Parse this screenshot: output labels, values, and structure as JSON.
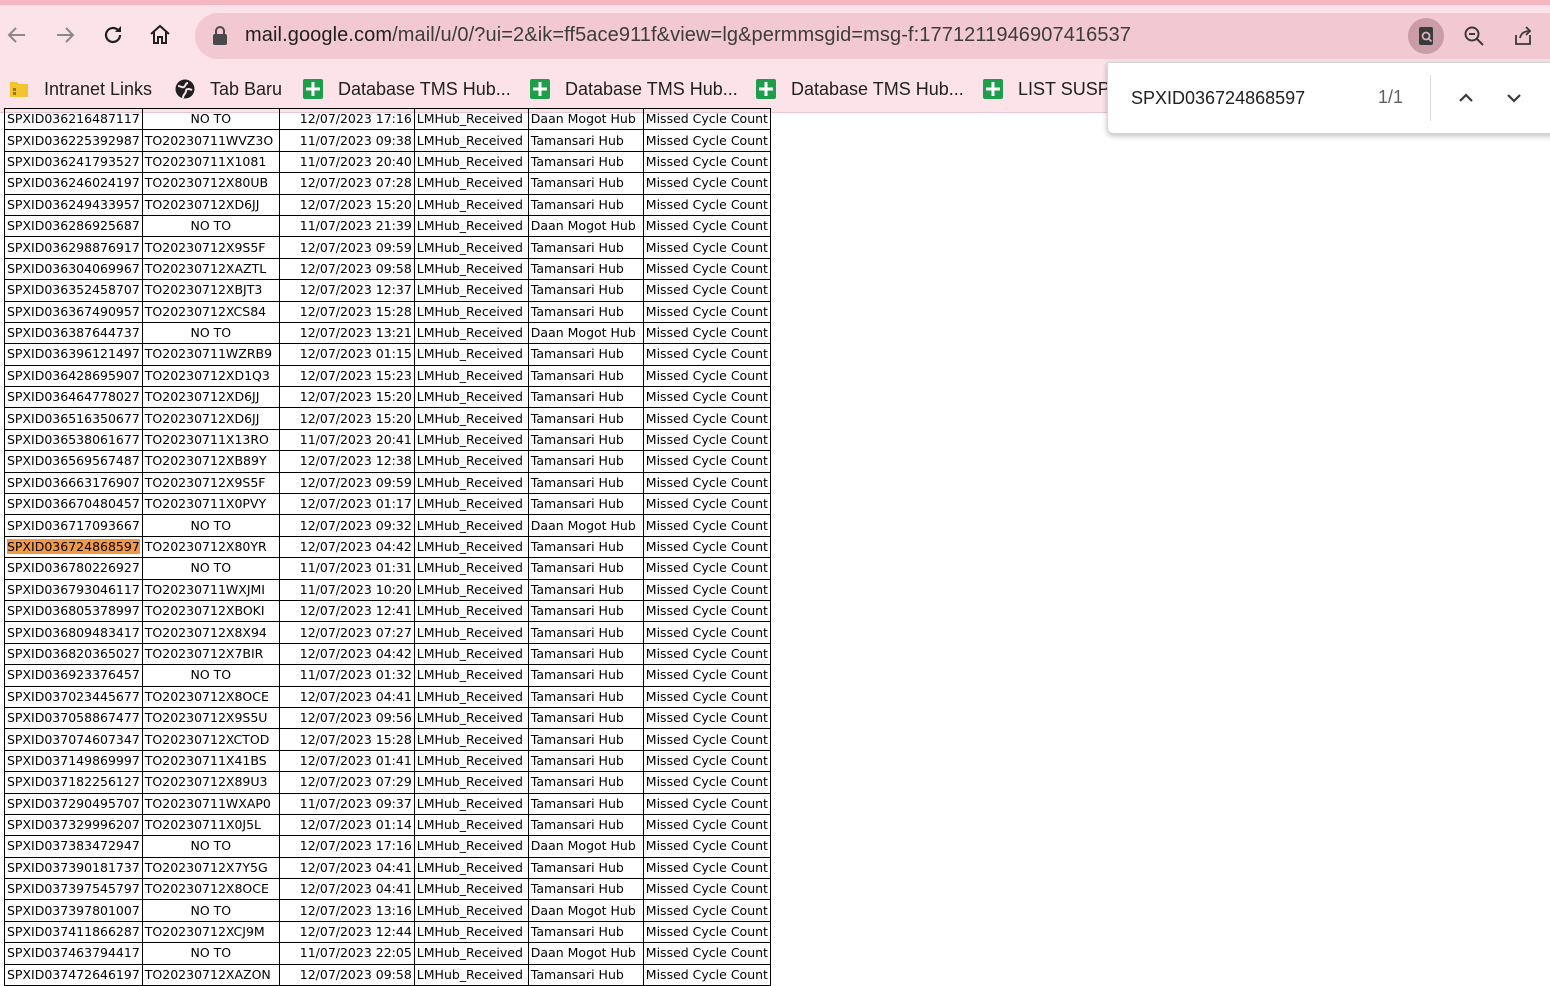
{
  "browser": {
    "url_host": "mail.google.com",
    "url_path": "/mail/u/0/?ui=2&ik=ff5ace911f&view=lg&permmsgid=msg-f:1771211946907416537",
    "icons": [
      "back-icon",
      "forward-icon",
      "reload-icon",
      "home-icon",
      "lock-icon",
      "find-icon",
      "zoom-icon",
      "share-icon"
    ]
  },
  "bookmarks": [
    {
      "label": "Intranet Links",
      "icon": "folder-icon"
    },
    {
      "label": "Tab Baru",
      "icon": "globe-icon"
    },
    {
      "label": "Database TMS Hub...",
      "icon": "sheets-icon"
    },
    {
      "label": "Database TMS Hub...",
      "icon": "sheets-icon"
    },
    {
      "label": "Database TMS Hub...",
      "icon": "sheets-icon"
    },
    {
      "label": "LIST SUSPEI",
      "icon": "sheets-icon"
    }
  ],
  "find_bar": {
    "query": "SPXID036724868597",
    "count": "1/1"
  },
  "highlight_color": "#f19a45",
  "table": {
    "rows": [
      [
        "SPXID036216487117",
        "NO TO",
        "12/07/2023 17:16",
        "LMHub_Received",
        "Daan Mogot Hub",
        "Missed Cycle Count"
      ],
      [
        "SPXID036225392987",
        "TO20230711WVZ3O",
        "11/07/2023 09:38",
        "LMHub_Received",
        "Tamansari Hub",
        "Missed Cycle Count"
      ],
      [
        "SPXID036241793527",
        "TO20230711X1081",
        "11/07/2023 20:40",
        "LMHub_Received",
        "Tamansari Hub",
        "Missed Cycle Count"
      ],
      [
        "SPXID036246024197",
        "TO20230712X80UB",
        "12/07/2023 07:28",
        "LMHub_Received",
        "Tamansari Hub",
        "Missed Cycle Count"
      ],
      [
        "SPXID036249433957",
        "TO20230712XD6JJ",
        "12/07/2023 15:20",
        "LMHub_Received",
        "Tamansari Hub",
        "Missed Cycle Count"
      ],
      [
        "SPXID036286925687",
        "NO TO",
        "11/07/2023 21:39",
        "LMHub_Received",
        "Daan Mogot Hub",
        "Missed Cycle Count"
      ],
      [
        "SPXID036298876917",
        "TO20230712X9S5F",
        "12/07/2023 09:59",
        "LMHub_Received",
        "Tamansari Hub",
        "Missed Cycle Count"
      ],
      [
        "SPXID036304069967",
        "TO20230712XAZTL",
        "12/07/2023 09:58",
        "LMHub_Received",
        "Tamansari Hub",
        "Missed Cycle Count"
      ],
      [
        "SPXID036352458707",
        "TO20230712XBJT3",
        "12/07/2023 12:37",
        "LMHub_Received",
        "Tamansari Hub",
        "Missed Cycle Count"
      ],
      [
        "SPXID036367490957",
        "TO20230712XCS84",
        "12/07/2023 15:28",
        "LMHub_Received",
        "Tamansari Hub",
        "Missed Cycle Count"
      ],
      [
        "SPXID036387644737",
        "NO TO",
        "12/07/2023 13:21",
        "LMHub_Received",
        "Daan Mogot Hub",
        "Missed Cycle Count"
      ],
      [
        "SPXID036396121497",
        "TO20230711WZRB9",
        "12/07/2023 01:15",
        "LMHub_Received",
        "Tamansari Hub",
        "Missed Cycle Count"
      ],
      [
        "SPXID036428695907",
        "TO20230712XD1Q3",
        "12/07/2023 15:23",
        "LMHub_Received",
        "Tamansari Hub",
        "Missed Cycle Count"
      ],
      [
        "SPXID036464778027",
        "TO20230712XD6JJ",
        "12/07/2023 15:20",
        "LMHub_Received",
        "Tamansari Hub",
        "Missed Cycle Count"
      ],
      [
        "SPXID036516350677",
        "TO20230712XD6JJ",
        "12/07/2023 15:20",
        "LMHub_Received",
        "Tamansari Hub",
        "Missed Cycle Count"
      ],
      [
        "SPXID036538061677",
        "TO20230711X13RO",
        "11/07/2023 20:41",
        "LMHub_Received",
        "Tamansari Hub",
        "Missed Cycle Count"
      ],
      [
        "SPXID036569567487",
        "TO20230712XB89Y",
        "12/07/2023 12:38",
        "LMHub_Received",
        "Tamansari Hub",
        "Missed Cycle Count"
      ],
      [
        "SPXID036663176907",
        "TO20230712X9S5F",
        "12/07/2023 09:59",
        "LMHub_Received",
        "Tamansari Hub",
        "Missed Cycle Count"
      ],
      [
        "SPXID036670480457",
        "TO20230711X0PVY",
        "12/07/2023 01:17",
        "LMHub_Received",
        "Tamansari Hub",
        "Missed Cycle Count"
      ],
      [
        "SPXID036717093667",
        "NO TO",
        "12/07/2023 09:32",
        "LMHub_Received",
        "Daan Mogot Hub",
        "Missed Cycle Count"
      ],
      [
        "SPXID036724868597",
        "TO20230712X80YR",
        "12/07/2023 04:42",
        "LMHub_Received",
        "Tamansari Hub",
        "Missed Cycle Count"
      ],
      [
        "SPXID036780226927",
        "NO TO",
        "11/07/2023 01:31",
        "LMHub_Received",
        "Tamansari Hub",
        "Missed Cycle Count"
      ],
      [
        "SPXID036793046117",
        "TO20230711WXJMI",
        "11/07/2023 10:20",
        "LMHub_Received",
        "Tamansari Hub",
        "Missed Cycle Count"
      ],
      [
        "SPXID036805378997",
        "TO20230712XBOKI",
        "12/07/2023 12:41",
        "LMHub_Received",
        "Tamansari Hub",
        "Missed Cycle Count"
      ],
      [
        "SPXID036809483417",
        "TO20230712X8X94",
        "12/07/2023 07:27",
        "LMHub_Received",
        "Tamansari Hub",
        "Missed Cycle Count"
      ],
      [
        "SPXID036820365027",
        "TO20230712X7BIR",
        "12/07/2023 04:42",
        "LMHub_Received",
        "Tamansari Hub",
        "Missed Cycle Count"
      ],
      [
        "SPXID036923376457",
        "NO TO",
        "11/07/2023 01:32",
        "LMHub_Received",
        "Tamansari Hub",
        "Missed Cycle Count"
      ],
      [
        "SPXID037023445677",
        "TO20230712X8OCE",
        "12/07/2023 04:41",
        "LMHub_Received",
        "Tamansari Hub",
        "Missed Cycle Count"
      ],
      [
        "SPXID037058867477",
        "TO20230712X9S5U",
        "12/07/2023 09:56",
        "LMHub_Received",
        "Tamansari Hub",
        "Missed Cycle Count"
      ],
      [
        "SPXID037074607347",
        "TO20230712XCTOD",
        "12/07/2023 15:28",
        "LMHub_Received",
        "Tamansari Hub",
        "Missed Cycle Count"
      ],
      [
        "SPXID037149869997",
        "TO20230711X41BS",
        "12/07/2023 01:41",
        "LMHub_Received",
        "Tamansari Hub",
        "Missed Cycle Count"
      ],
      [
        "SPXID037182256127",
        "TO20230712X89U3",
        "12/07/2023 07:29",
        "LMHub_Received",
        "Tamansari Hub",
        "Missed Cycle Count"
      ],
      [
        "SPXID037290495707",
        "TO20230711WXAP0",
        "11/07/2023 09:37",
        "LMHub_Received",
        "Tamansari Hub",
        "Missed Cycle Count"
      ],
      [
        "SPXID037329996207",
        "TO20230711X0J5L",
        "12/07/2023 01:14",
        "LMHub_Received",
        "Tamansari Hub",
        "Missed Cycle Count"
      ],
      [
        "SPXID037383472947",
        "NO TO",
        "12/07/2023 17:16",
        "LMHub_Received",
        "Daan Mogot Hub",
        "Missed Cycle Count"
      ],
      [
        "SPXID037390181737",
        "TO20230712X7Y5G",
        "12/07/2023 04:41",
        "LMHub_Received",
        "Tamansari Hub",
        "Missed Cycle Count"
      ],
      [
        "SPXID037397545797",
        "TO20230712X8OCE",
        "12/07/2023 04:41",
        "LMHub_Received",
        "Tamansari Hub",
        "Missed Cycle Count"
      ],
      [
        "SPXID037397801007",
        "NO TO",
        "12/07/2023 13:16",
        "LMHub_Received",
        "Daan Mogot Hub",
        "Missed Cycle Count"
      ],
      [
        "SPXID037411866287",
        "TO20230712XCJ9M",
        "12/07/2023 12:44",
        "LMHub_Received",
        "Tamansari Hub",
        "Missed Cycle Count"
      ],
      [
        "SPXID037463794417",
        "NO TO",
        "11/07/2023 22:05",
        "LMHub_Received",
        "Daan Mogot Hub",
        "Missed Cycle Count"
      ],
      [
        "SPXID037472646197",
        "TO20230712XAZON",
        "12/07/2023 09:58",
        "LMHub_Received",
        "Tamansari Hub",
        "Missed Cycle Count"
      ]
    ]
  }
}
